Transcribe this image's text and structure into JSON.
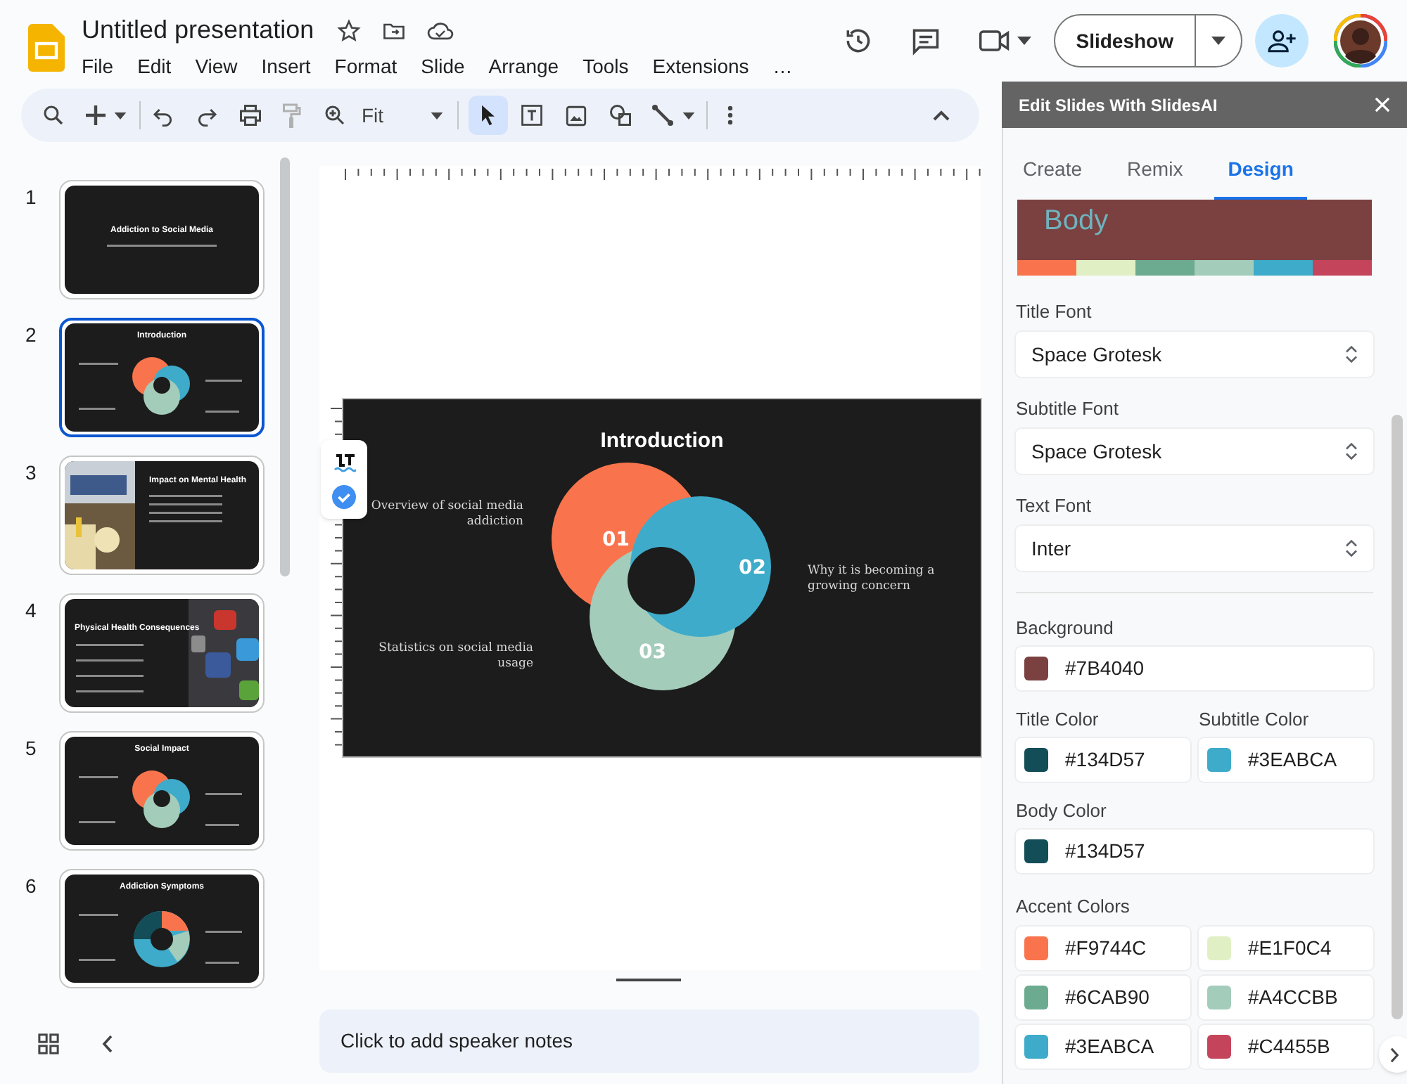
{
  "document_title": "Untitled presentation",
  "menu": [
    "File",
    "Edit",
    "View",
    "Insert",
    "Format",
    "Slide",
    "Arrange",
    "Tools",
    "Extensions",
    "…"
  ],
  "toolbar": {
    "zoom": "Fit"
  },
  "slideshow_button": "Slideshow",
  "filmstrip": [
    {
      "number": "1",
      "title": "Addiction to Social Media",
      "kind": "title",
      "selected": false
    },
    {
      "number": "2",
      "title": "Introduction",
      "kind": "ring",
      "selected": true
    },
    {
      "number": "3",
      "title": "Impact on Mental Health",
      "kind": "image-left",
      "selected": false
    },
    {
      "number": "4",
      "title": "Physical Health Consequences",
      "kind": "image-right",
      "selected": false
    },
    {
      "number": "5",
      "title": "Social Impact",
      "kind": "ring",
      "selected": false
    },
    {
      "number": "6",
      "title": "Addiction Symptoms",
      "kind": "donut",
      "selected": false
    }
  ],
  "slide": {
    "title": "Introduction",
    "items": [
      {
        "number": "01",
        "text": "Overview of social media addiction",
        "color": "#f9744c"
      },
      {
        "number": "02",
        "text": "Why it is becoming a growing concern",
        "color": "#3eabca"
      },
      {
        "number": "03",
        "text": "Statistics on social media usage",
        "color": "#a4ccbb"
      }
    ]
  },
  "speaker_notes": {
    "placeholder": "Click to add speaker notes"
  },
  "panel": {
    "title": "Edit Slides With SlidesAI",
    "tabs": [
      {
        "label": "Create",
        "selected": false
      },
      {
        "label": "Remix",
        "selected": false
      },
      {
        "label": "Design",
        "selected": true
      }
    ],
    "preview": {
      "text": "Body"
    },
    "fonts": [
      {
        "label": "Title Font",
        "value": "Space Grotesk"
      },
      {
        "label": "Subtitle Font",
        "value": "Space Grotesk"
      },
      {
        "label": "Text Font",
        "value": "Inter"
      }
    ],
    "background": {
      "label": "Background",
      "value": "#7B4040"
    },
    "title_color": {
      "label": "Title Color",
      "value": "#134D57"
    },
    "subtitle_color": {
      "label": "Subtitle Color",
      "value": "#3EABCA"
    },
    "body_color": {
      "label": "Body Color",
      "value": "#134D57"
    },
    "accent_colors": {
      "label": "Accent Colors",
      "values": [
        "#F9744C",
        "#E1F0C4",
        "#6CAB90",
        "#A4CCBB",
        "#3EABCA",
        "#C4455B"
      ]
    }
  }
}
